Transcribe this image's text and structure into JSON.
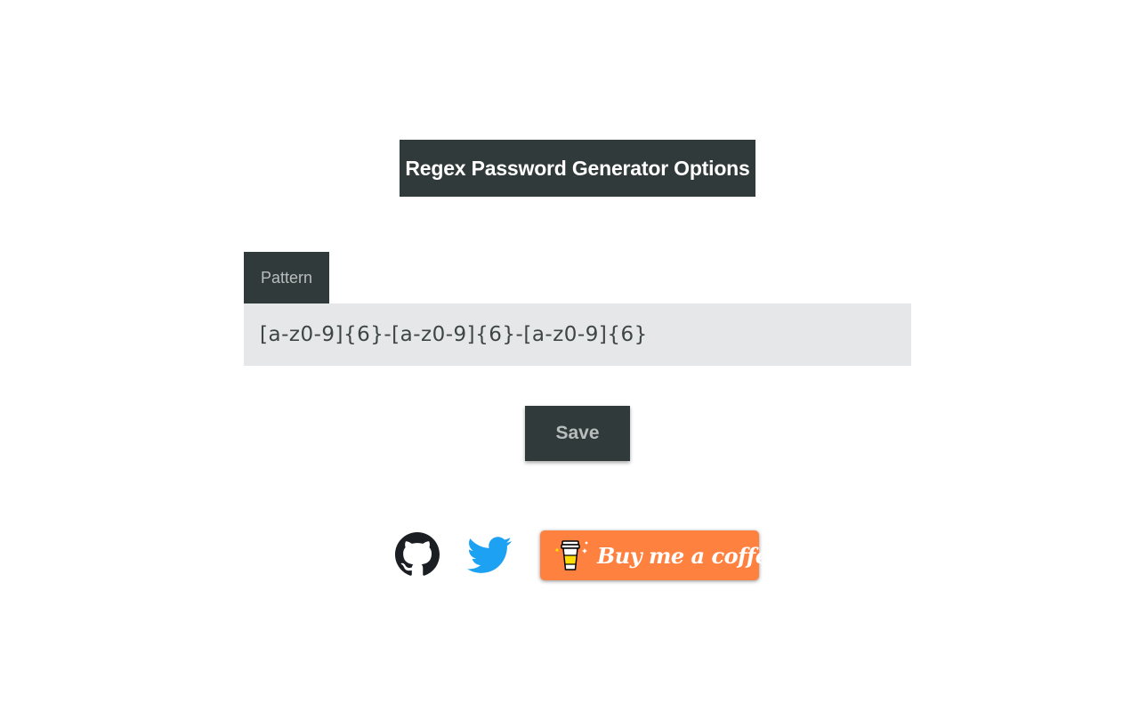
{
  "header": {
    "title": "Regex Password Generator Options"
  },
  "form": {
    "pattern_label": "Pattern",
    "pattern_value": "[a-z0-9]{6}-[a-z0-9]{6}-[a-z0-9]{6}",
    "save_label": "Save"
  },
  "footer": {
    "github_icon": "github-icon",
    "twitter_icon": "twitter-icon",
    "bmc_label": "Buy me a coffee",
    "bmc_icon": "coffee-cup-icon",
    "colors": {
      "dark": "#313a3a",
      "input_bg": "#e6e7e9",
      "bmc_orange": "#ff813f",
      "twitter_blue": "#1da1f2"
    }
  }
}
